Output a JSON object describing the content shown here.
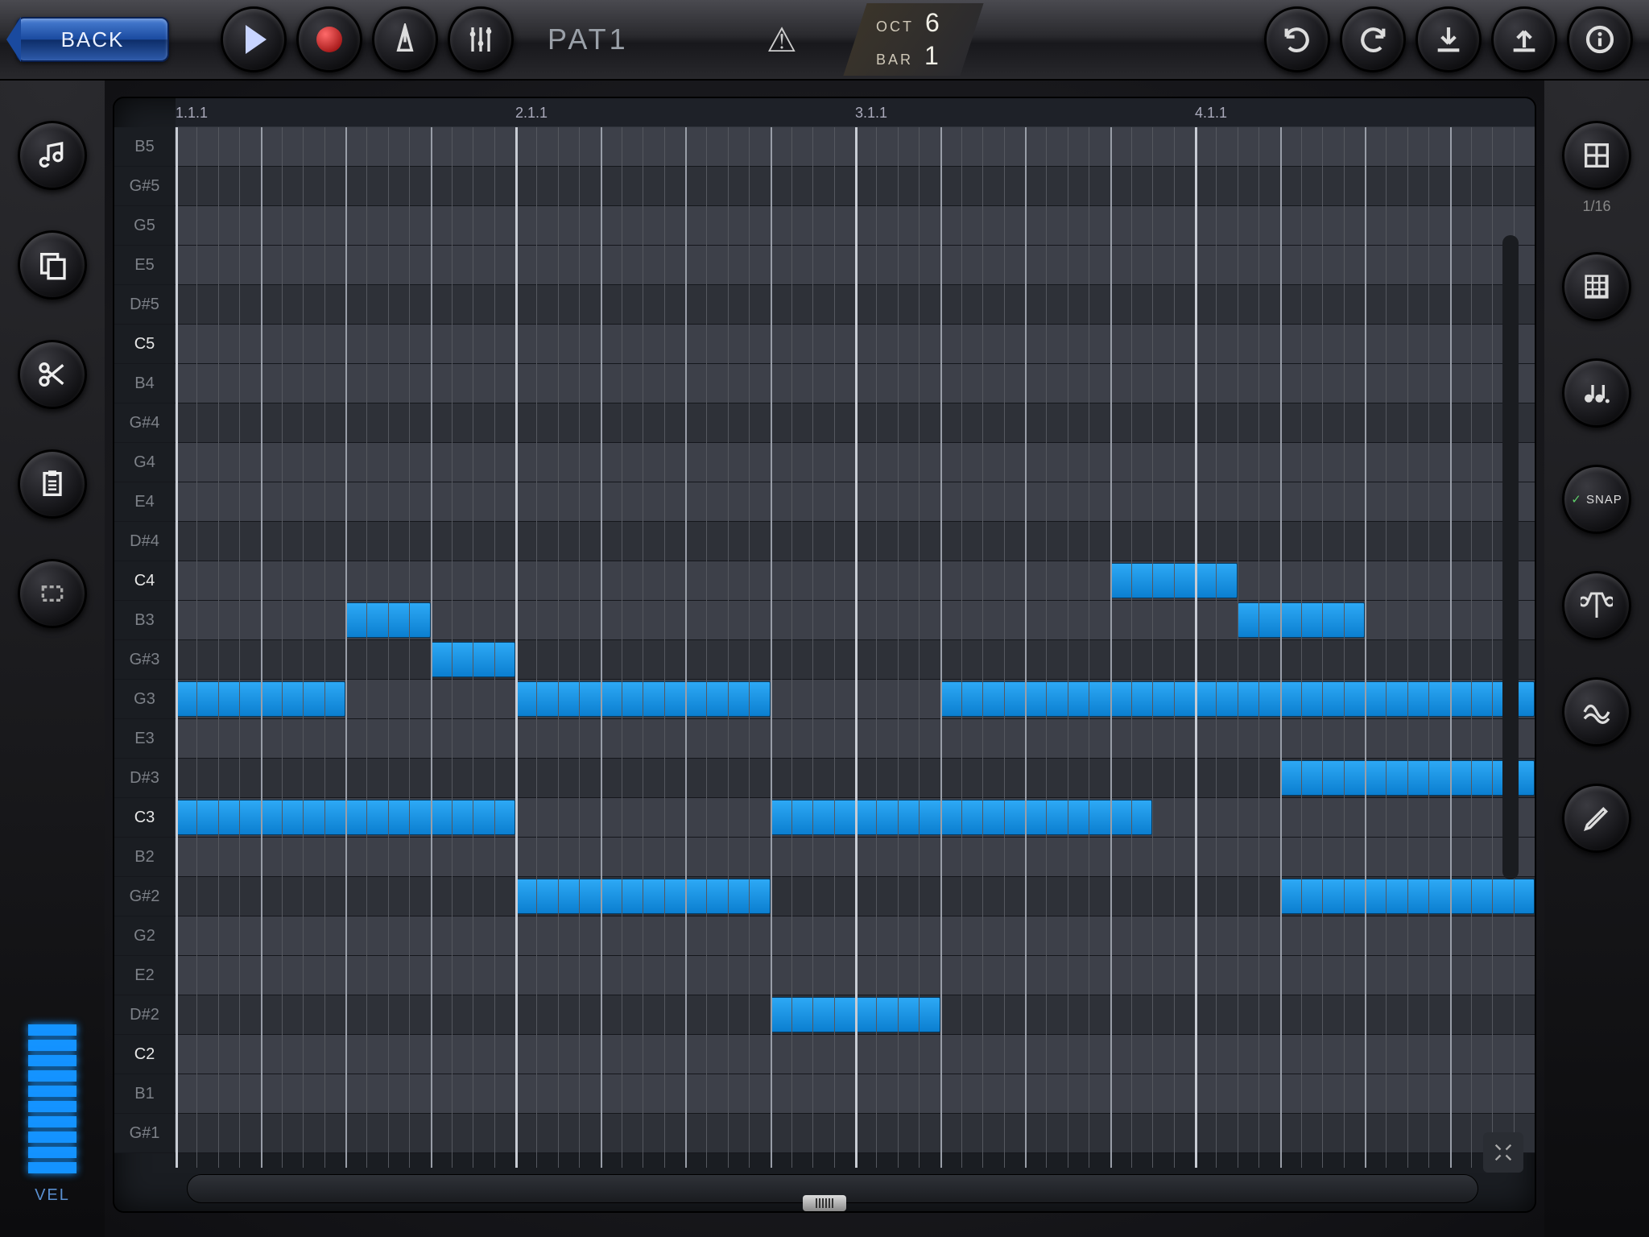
{
  "header": {
    "back_label": "BACK",
    "pattern_name": "PAT1",
    "oct_label": "OCT",
    "oct_value": "6",
    "bar_label": "BAR",
    "bar_value": "1"
  },
  "ruler_ticks": [
    "1.1.1",
    "2.1.1",
    "3.1.1",
    "4.1.1"
  ],
  "grid": {
    "steps_per_bar": 16,
    "bars": 4,
    "snap_label": "SNAP",
    "division_label": "1/16"
  },
  "velocity_label": "VEL",
  "velocity_bars": 10,
  "pitch_rows": [
    {
      "label": "B5",
      "sharp": false
    },
    {
      "label": "G#5",
      "sharp": true
    },
    {
      "label": "G5",
      "sharp": false
    },
    {
      "label": "E5",
      "sharp": false
    },
    {
      "label": "D#5",
      "sharp": true
    },
    {
      "label": "C5",
      "sharp": false,
      "c": true
    },
    {
      "label": "B4",
      "sharp": false
    },
    {
      "label": "G#4",
      "sharp": true
    },
    {
      "label": "G4",
      "sharp": false
    },
    {
      "label": "E4",
      "sharp": false
    },
    {
      "label": "D#4",
      "sharp": true
    },
    {
      "label": "C4",
      "sharp": false,
      "c": true
    },
    {
      "label": "B3",
      "sharp": false
    },
    {
      "label": "G#3",
      "sharp": true
    },
    {
      "label": "G3",
      "sharp": false
    },
    {
      "label": "E3",
      "sharp": false
    },
    {
      "label": "D#3",
      "sharp": true
    },
    {
      "label": "C3",
      "sharp": false,
      "c": true
    },
    {
      "label": "B2",
      "sharp": false
    },
    {
      "label": "G#2",
      "sharp": true
    },
    {
      "label": "G2",
      "sharp": false
    },
    {
      "label": "E2",
      "sharp": false
    },
    {
      "label": "D#2",
      "sharp": true
    },
    {
      "label": "C2",
      "sharp": false,
      "c": true
    },
    {
      "label": "B1",
      "sharp": false
    },
    {
      "label": "G#1",
      "sharp": true
    }
  ],
  "notes": [
    {
      "pitch": "C4",
      "start": 44,
      "len": 6
    },
    {
      "pitch": "B3",
      "start": 8,
      "len": 4
    },
    {
      "pitch": "B3",
      "start": 50,
      "len": 6
    },
    {
      "pitch": "G#3",
      "start": 12,
      "len": 4
    },
    {
      "pitch": "G3",
      "start": 0,
      "len": 8
    },
    {
      "pitch": "G3",
      "start": 16,
      "len": 12
    },
    {
      "pitch": "G3",
      "start": 36,
      "len": 28
    },
    {
      "pitch": "D#3",
      "start": 52,
      "len": 12
    },
    {
      "pitch": "C3",
      "start": 0,
      "len": 16
    },
    {
      "pitch": "C3",
      "start": 28,
      "len": 18
    },
    {
      "pitch": "G#2",
      "start": 16,
      "len": 12
    },
    {
      "pitch": "G#2",
      "start": 52,
      "len": 12
    },
    {
      "pitch": "D#2",
      "start": 28,
      "len": 8
    }
  ],
  "colors": {
    "note": "#1493ff",
    "accent": "#1a4a9f"
  }
}
